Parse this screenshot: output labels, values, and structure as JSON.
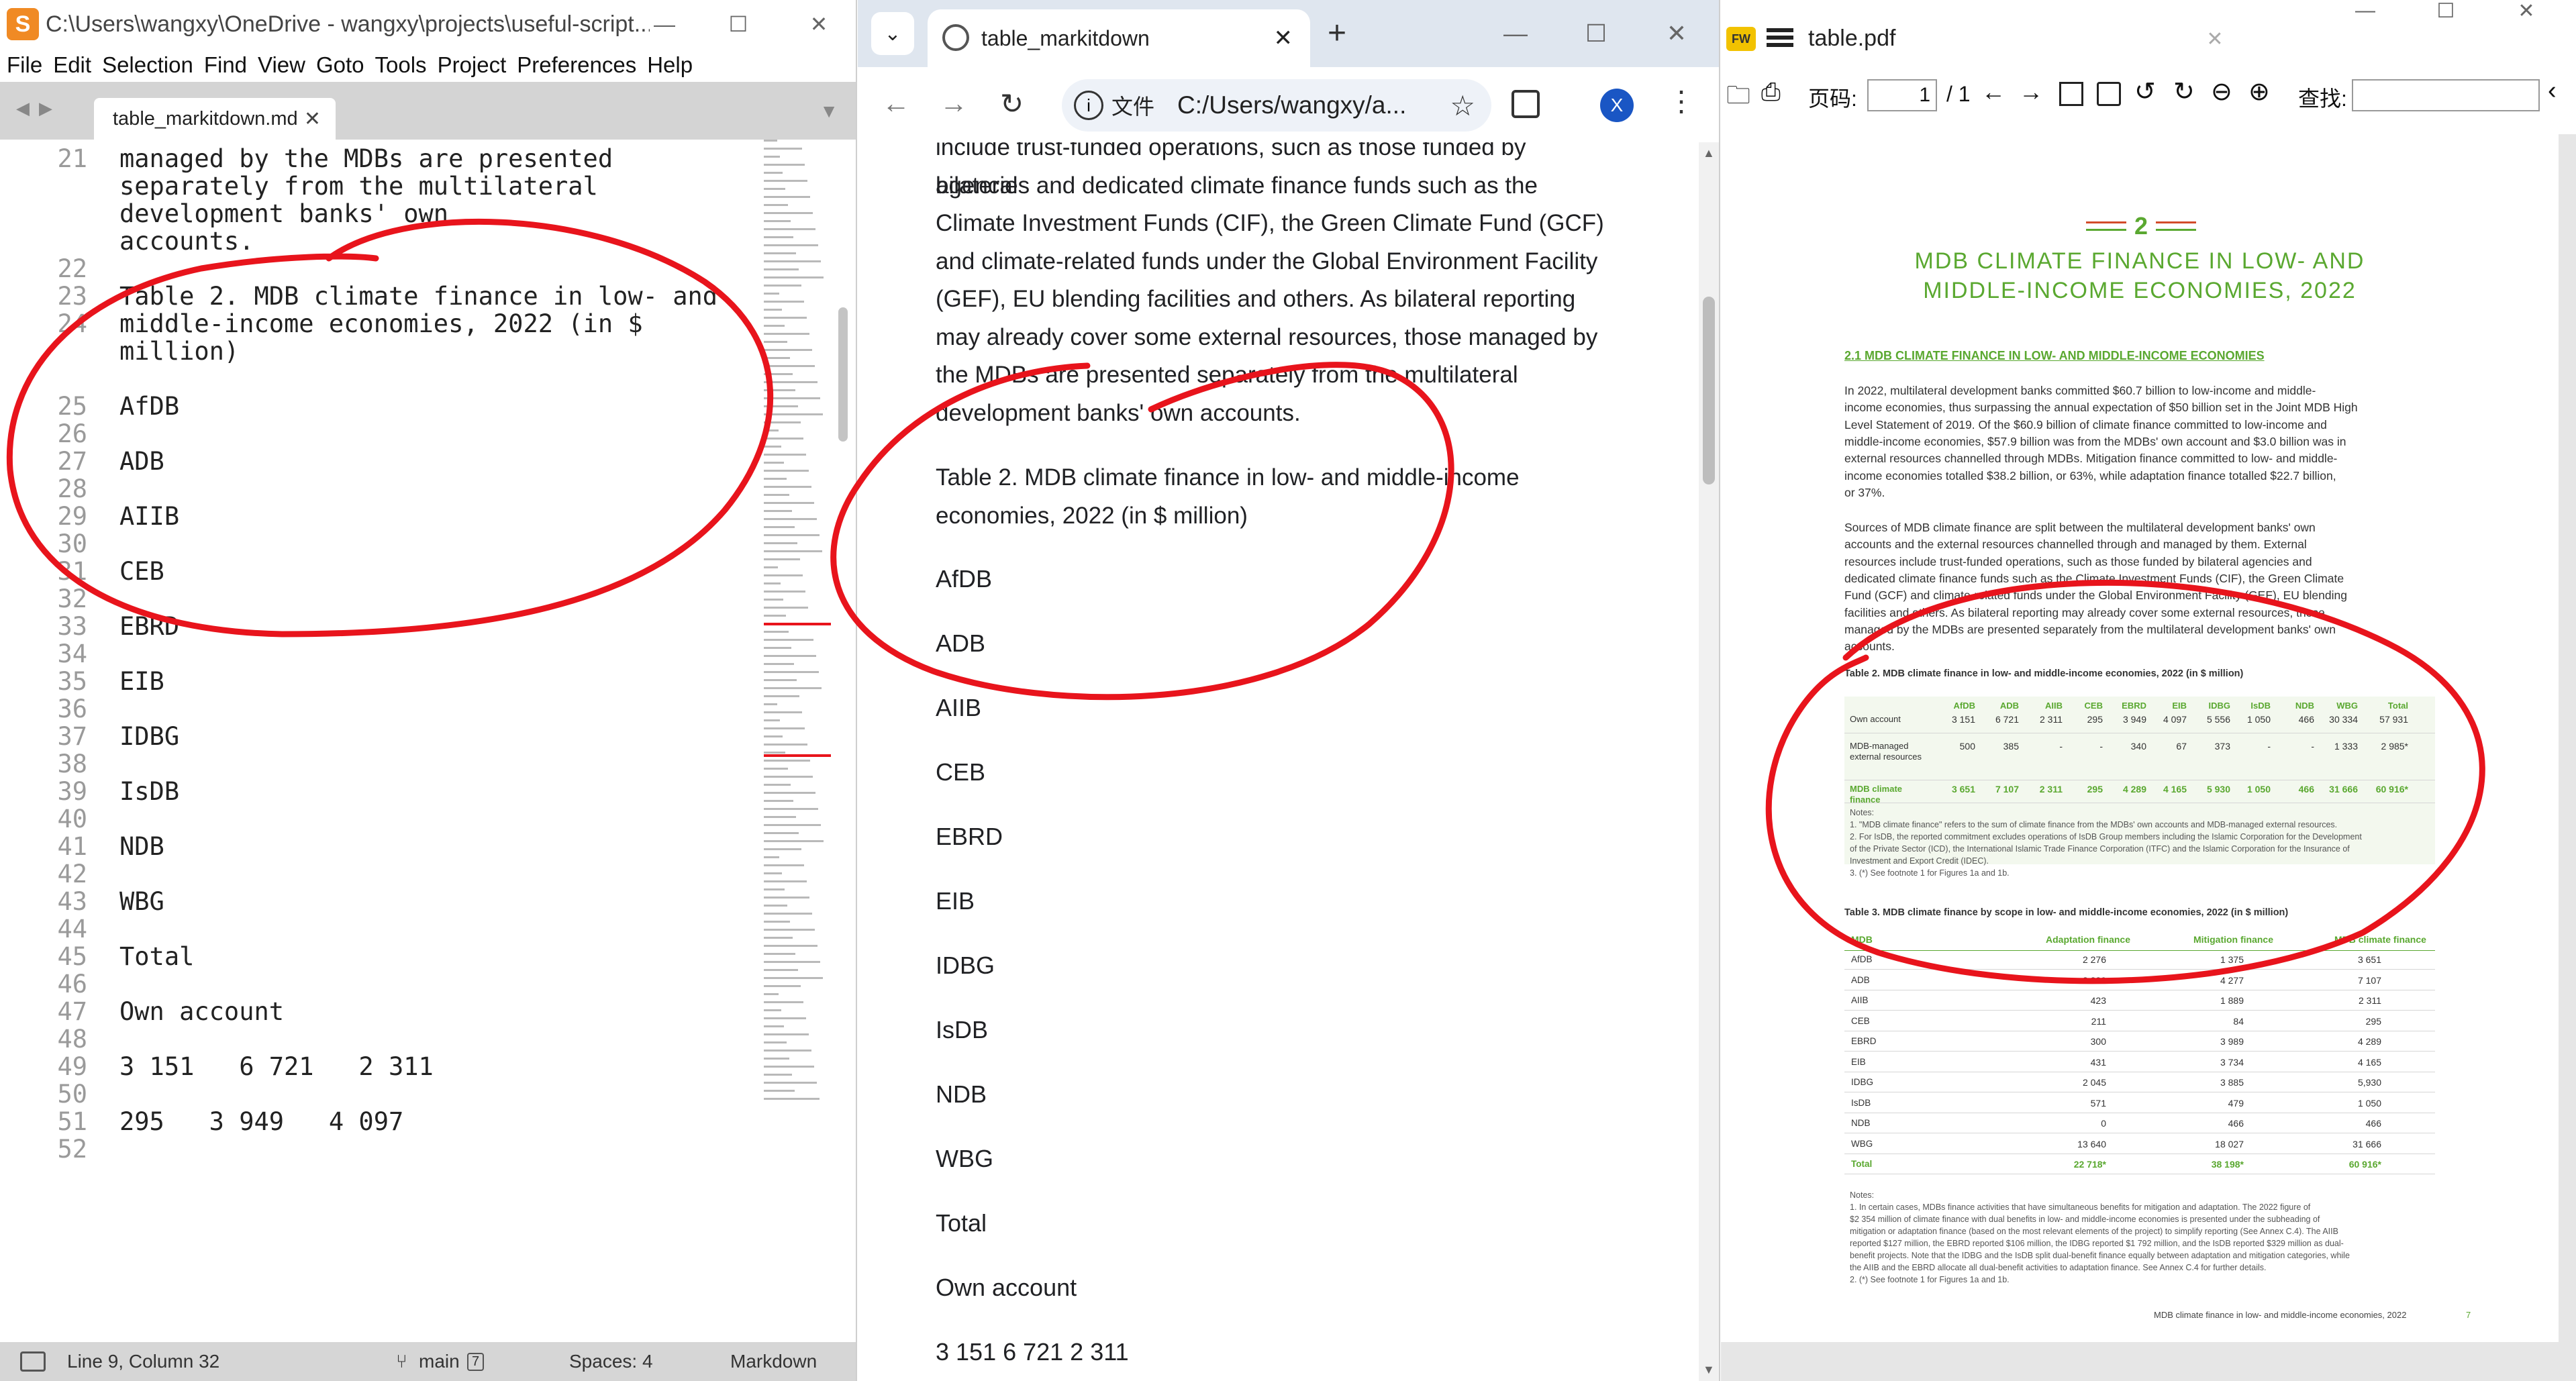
{
  "sublime": {
    "title": "C:\\Users\\wangxy\\OneDrive - wangxy\\projects\\useful-script...",
    "menu": [
      "File",
      "Edit",
      "Selection",
      "Find",
      "View",
      "Goto",
      "Tools",
      "Project",
      "Preferences",
      "Help"
    ],
    "tab_name": "table_markitdown.md",
    "line_numbers": [
      "21",
      "22",
      "23",
      "24",
      "25",
      "26",
      "27",
      "28",
      "29",
      "30",
      "31",
      "32",
      "33",
      "34",
      "35",
      "36",
      "37",
      "38",
      "39",
      "40",
      "41",
      "42",
      "43",
      "44",
      "45",
      "46",
      "47",
      "48",
      "49",
      "50",
      "51",
      "52"
    ],
    "lines": [
      "managed by the MDBs are presented",
      "separately from the multilateral",
      "development banks' own",
      "accounts.",
      "",
      "Table 2. MDB climate finance in low- and",
      "middle-income economies, 2022 (in $",
      "million)",
      "",
      "AfDB",
      "",
      "ADB",
      "",
      "AIIB",
      "",
      "CEB",
      "",
      "EBRD",
      "",
      "EIB",
      "",
      "IDBG",
      "",
      "IsDB",
      "",
      "NDB",
      "",
      "WBG",
      "",
      "Total",
      "",
      "Own account",
      "",
      "3 151   6 721   2 311",
      "",
      "295   3 949   4 097"
    ],
    "status": {
      "position": "Line 9, Column 32",
      "branch": "main",
      "branch_badge": "7",
      "spaces": "Spaces: 4",
      "syntax": "Markdown"
    }
  },
  "chrome": {
    "tab_title": "table_markitdown",
    "omnibox_label": "文件",
    "url": "C:/Users/wangxy/a...",
    "profile": "X",
    "paragraph_lines": [
      "include trust-funded operations, such as those funded by bilateral",
      "agencies and dedicated climate finance funds such as the",
      "Climate Investment Funds (CIF), the Green Climate Fund (GCF)",
      "and climate-related funds under the Global Environment Facility",
      "(GEF), EU blending facilities and others. As bilateral reporting",
      "may already cover some external resources, those managed by",
      "the MDBs are presented separately from the multilateral",
      "development banks' own accounts."
    ],
    "caption_lines": [
      "Table 2. MDB climate finance in low- and middle-income",
      "economies, 2022 (in $ million)"
    ],
    "items": [
      "AfDB",
      "ADB",
      "AIIB",
      "CEB",
      "EBRD",
      "EIB",
      "IDBG",
      "IsDB",
      "NDB",
      "WBG",
      "Total",
      "Own account",
      "3 151 6 721 2 311"
    ]
  },
  "pdf": {
    "doc_title": "table.pdf",
    "page_label": "页码:",
    "page_value": "1",
    "page_total": "/ 1",
    "find_label": "查找:",
    "chapter_number": "2",
    "chapter_title_1": "MDB CLIMATE FINANCE IN LOW- AND",
    "chapter_title_2": "MIDDLE-INCOME ECONOMIES, 2022",
    "section_heading": "2.1 MDB CLIMATE FINANCE IN LOW- AND MIDDLE-INCOME ECONOMIES",
    "para1": [
      "In 2022, multilateral development banks committed $60.7 billion to low-income and middle-",
      "income economies, thus surpassing the annual expectation of $50 billion set in the Joint MDB High",
      "Level Statement of 2019. Of the $60.9 billion of climate finance committed to low-income and",
      "middle-income economies, $57.9 billion was from the MDBs' own account and $3.0 billion was in",
      "external resources channelled through MDBs. Mitigation finance committed to low- and middle-",
      "income economies totalled $38.2 billion, or 63%, while adaptation finance totalled $22.7 billion,",
      "or 37%."
    ],
    "para2": [
      "Sources of MDB climate finance are split between the multilateral development banks' own",
      "accounts and the external resources channelled through and managed by them. External",
      "resources include trust-funded operations, such as those funded by bilateral agencies and",
      "dedicated climate finance funds such as the Climate Investment Funds (CIF), the Green Climate",
      "Fund (GCF) and climate-related funds under the Global Environment Facility (GEF), EU blending",
      "facilities and others. As bilateral reporting may already cover some external resources, those",
      "managed by the MDBs are presented separately from the multilateral development banks' own",
      "accounts."
    ],
    "table2": {
      "caption": "Table 2. MDB climate finance in low- and middle-income economies, 2022 (in $ million)",
      "headers": [
        "AfDB",
        "ADB",
        "AIIB",
        "CEB",
        "EBRD",
        "EIB",
        "IDBG",
        "IsDB",
        "NDB",
        "WBG",
        "Total"
      ],
      "rows": [
        {
          "label": "Own account",
          "values": [
            "3 151",
            "6 721",
            "2 311",
            "295",
            "3 949",
            "4 097",
            "5 556",
            "1 050",
            "466",
            "30 334",
            "57 931"
          ]
        },
        {
          "label": "MDB-managed external resources",
          "values": [
            "500",
            "385",
            "-",
            "-",
            "340",
            "67",
            "373",
            "-",
            "-",
            "1 333",
            "2 985*"
          ]
        },
        {
          "label": "MDB climate finance",
          "values": [
            "3 651",
            "7 107",
            "2 311",
            "295",
            "4 289",
            "4 165",
            "5 930",
            "1 050",
            "466",
            "31 666",
            "60 916*"
          ]
        }
      ],
      "notes": [
        "Notes:",
        "1.   \"MDB climate finance\" refers to the sum of climate finance from the MDBs' own accounts and MDB-managed external resources.",
        "2.   For IsDB, the reported commitment excludes operations of IsDB Group members including the Islamic Corporation for the Development",
        "      of the Private Sector (ICD), the International Islamic Trade Finance Corporation (ITFC) and the Islamic Corporation for the Insurance of",
        "      Investment and Export Credit (IDEC).",
        "3.   (*) See footnote 1 for Figures 1a and 1b."
      ]
    },
    "table3": {
      "caption": "Table 3. MDB climate finance by scope in low- and middle-income economies, 2022 (in $ million)",
      "headers": [
        "MDB",
        "Adaptation finance",
        "Mitigation finance",
        "MDB climate finance"
      ],
      "rows": [
        [
          "AfDB",
          "2 276",
          "1 375",
          "3 651"
        ],
        [
          "ADB",
          "2 829",
          "4 277",
          "7 107"
        ],
        [
          "AIIB",
          "423",
          "1 889",
          "2 311"
        ],
        [
          "CEB",
          "211",
          "84",
          "295"
        ],
        [
          "EBRD",
          "300",
          "3 989",
          "4 289"
        ],
        [
          "EIB",
          "431",
          "3 734",
          "4 165"
        ],
        [
          "IDBG",
          "2 045",
          "3 885",
          "5,930"
        ],
        [
          "IsDB",
          "571",
          "479",
          "1 050"
        ],
        [
          "NDB",
          "0",
          "466",
          "466"
        ],
        [
          "WBG",
          "13 640",
          "18 027",
          "31 666"
        ],
        [
          "Total",
          "22 718*",
          "38 198*",
          "60 916*"
        ]
      ],
      "notes": [
        "Notes:",
        "1.   In certain cases, MDBs finance activities that have simultaneous benefits for mitigation and adaptation. The 2022 figure of",
        "      $2 354 million of climate finance with dual benefits in low- and middle-income economies is presented under the subheading of",
        "      mitigation or adaptation finance (based on the most relevant elements of the project) to simplify reporting (See Annex C.4). The AIIB",
        "      reported $127 million, the EBRD reported $106 million, the IDBG reported $1 792 million, and the IsDB reported $329 million as dual-",
        "      benefit projects. Note that the IDBG and the IsDB split dual-benefit finance equally between adaptation and mitigation categories, while",
        "      the AIIB and the EBRD allocate all dual-benefit activities to adaptation finance. See Annex C.4 for further details.",
        "2.   (*) See footnote 1 for Figures 1a and 1b."
      ]
    },
    "footer": "MDB climate finance in low- and middle-income economies, 2022",
    "footer_page": "7"
  },
  "colors": {
    "accent_green": "#5aa830",
    "annotation_red": "#e8141c",
    "chrome_frame": "#dfe6ef"
  }
}
